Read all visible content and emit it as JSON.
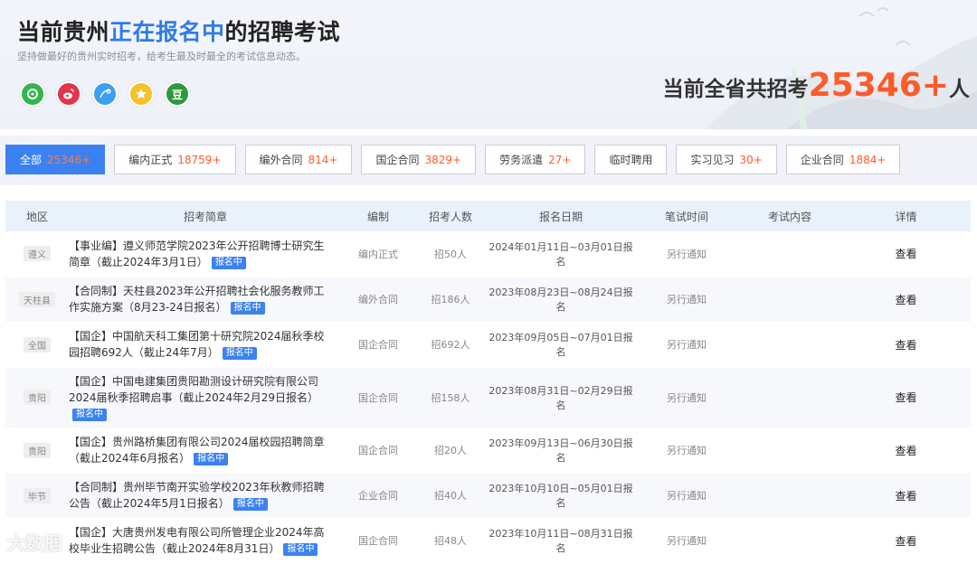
{
  "header": {
    "title_prefix": "当前贵州",
    "title_highlight": "正在报名中",
    "title_suffix": "的招聘考试",
    "subtitle": "坚持做最好的贵州实时招考，给考生最及时最全的考试信息动态。",
    "social_icons": [
      "wechat-icon",
      "weibo-icon",
      "qq-icon",
      "star-icon",
      "douban-icon"
    ],
    "douban_glyph": "豆",
    "total_prefix": "当前全省共招考",
    "total_number": "25346+",
    "total_suffix": "人"
  },
  "tabs": [
    {
      "label": "全部",
      "count": "25346+",
      "active": true
    },
    {
      "label": "编内正式",
      "count": "18759+"
    },
    {
      "label": "编外合同",
      "count": "814+"
    },
    {
      "label": "国企合同",
      "count": "3829+"
    },
    {
      "label": "劳务派遣",
      "count": "27+"
    },
    {
      "label": "临时聘用",
      "count": ""
    },
    {
      "label": "实习见习",
      "count": "30+"
    },
    {
      "label": "企业合同",
      "count": "1884+"
    }
  ],
  "table": {
    "headers": [
      "地区",
      "招考简章",
      "编制",
      "招考人数",
      "报名日期",
      "笔试时间",
      "考试内容",
      "详情"
    ],
    "badge_label": "报名中",
    "rows": [
      {
        "region": "遵义",
        "title": "【事业编】遵义师范学院2023年公开招聘博士研究生简章（截止2024年3月1日）",
        "type": "编内正式",
        "count": "招50人",
        "date": "2024年01月11日~03月01日报名",
        "exam": "另行通知",
        "content": "",
        "detail": "查看"
      },
      {
        "region": "天柱县",
        "title": "【合同制】天柱县2023年公开招聘社会化服务教师工作实施方案（8月23-24日报名）",
        "type": "编外合同",
        "count": "招186人",
        "date": "2023年08月23日~08月24日报名",
        "exam": "另行通知",
        "content": "",
        "detail": "查看"
      },
      {
        "region": "全国",
        "title": "【国企】中国航天科工集团第十研究院2024届秋季校园招聘692人（截止24年7月）",
        "type": "国企合同",
        "count": "招692人",
        "date": "2023年09月05日~07月01日报名",
        "exam": "另行通知",
        "content": "",
        "detail": "查看"
      },
      {
        "region": "贵阳",
        "title": "【国企】中国电建集团贵阳勘测设计研究院有限公司2024届秋季招聘启事（截止2024年2月29日报名）",
        "type": "国企合同",
        "count": "招158人",
        "date": "2023年08月31日~02月29日报名",
        "exam": "另行通知",
        "content": "",
        "detail": "查看"
      },
      {
        "region": "贵阳",
        "title": "【国企】贵州路桥集团有限公司2024届校园招聘简章（截止2024年6月报名）",
        "type": "国企合同",
        "count": "招20人",
        "date": "2023年09月13日~06月30日报名",
        "exam": "另行通知",
        "content": "",
        "detail": "查看"
      },
      {
        "region": "毕节",
        "title": "【合同制】贵州毕节南开实验学校2023年秋教师招聘公告（截止2024年5月1日报名）",
        "type": "企业合同",
        "count": "招40人",
        "date": "2023年10月10日~05月01日报名",
        "exam": "另行通知",
        "content": "",
        "detail": "查看"
      },
      {
        "region": "",
        "title": "【国企】大唐贵州发电有限公司所管理企业2024年高校毕业生招聘公告（截止2024年8月31日）",
        "type": "国企合同",
        "count": "招48人",
        "date": "2023年10月11日~08月31日报名",
        "exam": "另行通知",
        "content": "",
        "detail": "查看"
      }
    ]
  },
  "watermark": "大数据"
}
